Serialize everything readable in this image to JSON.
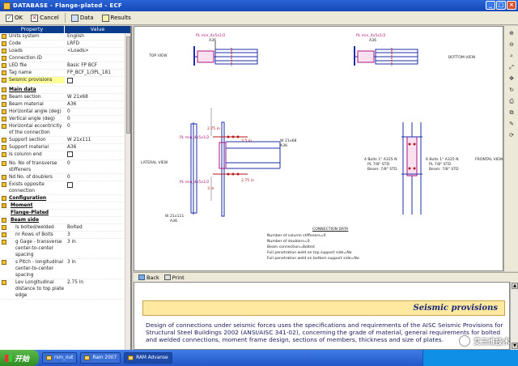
{
  "window": {
    "title": "DATABASE - Flange-plated - ECF",
    "icon": "app-icon"
  },
  "toolbar": {
    "ok": "OK",
    "cancel": "Cancel",
    "data": "Data",
    "results": "Results"
  },
  "props": {
    "header_property": "Property",
    "header_value": "Value",
    "rows": [
      {
        "name": "Units system",
        "value": "English"
      },
      {
        "name": "Code",
        "value": "LRFD"
      },
      {
        "name": "Loads",
        "value": "<Loads>"
      },
      {
        "name": "Connection ID",
        "value": ""
      },
      {
        "name": "LED file",
        "value": "Basic FP BCF"
      },
      {
        "name": "Tag name",
        "value": "FP_BCF_1/3PL_181"
      },
      {
        "name": "Seismic provisions",
        "value": ""
      }
    ],
    "main_data": "Main data",
    "main_rows": [
      {
        "name": "Beam section",
        "value": "W 21x68"
      },
      {
        "name": "Beam material",
        "value": "A36"
      },
      {
        "name": "Horizontal angle (deg)",
        "value": "0"
      },
      {
        "name": "Vertical angle (deg)",
        "value": "0"
      },
      {
        "name": "Horizontal eccentricity of the connection",
        "value": "0"
      },
      {
        "name": "Support section",
        "value": "W 21x111"
      },
      {
        "name": "Support material",
        "value": "A36"
      },
      {
        "name": "Is column end",
        "value": ""
      },
      {
        "name": "No. No of transverse stiffeners",
        "value": "0"
      },
      {
        "name": "Nd   No. of doublers",
        "value": "0"
      },
      {
        "name": "Exists opposite connection",
        "value": ""
      }
    ],
    "configuration": "Configuration",
    "moment": "Moment",
    "flange_plated": "Flange-Plated",
    "beam_side": "Beam side",
    "beam_rows": [
      {
        "name": "Is bolted/welded",
        "value": "Bolted"
      },
      {
        "name": "nr   Rows of Bolts",
        "value": "3"
      },
      {
        "name": "g    Gage - transverse center-to-center spacing",
        "value": "3 in"
      },
      {
        "name": "s    Pitch - longitudinal center-to-center spacing",
        "value": "3 in"
      },
      {
        "name": "Lev   Longitudinal distance to top plate edge",
        "value": "2.75 in"
      }
    ]
  },
  "drawing": {
    "top_view": "TOP VIEW",
    "bottom_view": "BOTTOM VIEW",
    "lateral_view": "LATERAL VIEW",
    "frontal_view": "FRONTAL VIEW",
    "pl_top_a": "PL min_4x5x1/2",
    "pl_top_mat": "A36",
    "pl_mid": "PL min_4x5x1/2",
    "pl_lower": "PL min_4x5x1/2",
    "beam_label": "W 21x68",
    "beam_mat": "A36",
    "col_label": "W 21x111",
    "col_mat": "A36",
    "bolts1": "4 Bolts 1\" A325 N",
    "bolts1_b": "PL 7/8\" STD",
    "bolts1_c": "Beam: 7/8\" STD",
    "bolts2": "6 Bolts 1\" A325 N",
    "bolts2_b": "PL 7/8\" STD",
    "bolts2_c": "Beam: 7/8\" STD",
    "dim1": "3.5 in",
    "dim2": "2.75 in",
    "dim3": "2.75 in",
    "dim4": "3 in",
    "conn_title": "CONNECTION DATA",
    "conn_lines": [
      "Number of column stiffeners=0",
      "Number of doublers=0",
      "Beam connection=Bolted",
      "Full penetration weld on top support side=No",
      "Full penetration weld on bottom support side=No"
    ]
  },
  "helpbar": {
    "back": "Back",
    "print": "Print"
  },
  "help": {
    "banner": "Seismic provisions",
    "text": "Design of connections under seismic forces uses the specifications and requirements of the AISC Seismic Provisions for Structural Steel Buildings 2002 (ANSI/AISC 341-02), concerning the grade of material, general requirements for bolted and welded connections, moment frame design, sections of members, thickness and size of plates."
  },
  "taskbar": {
    "start": "开始",
    "tasks": [
      "rsm_out",
      "Ram 2007",
      "RAM Advanse"
    ]
  },
  "watermark": "艾三维技术",
  "colors": {
    "accent": "#0a3b8c",
    "title": "#1648b8",
    "banner": "#ffe8a0",
    "beam": "#b0157f",
    "plate": "#1e2fa8"
  }
}
